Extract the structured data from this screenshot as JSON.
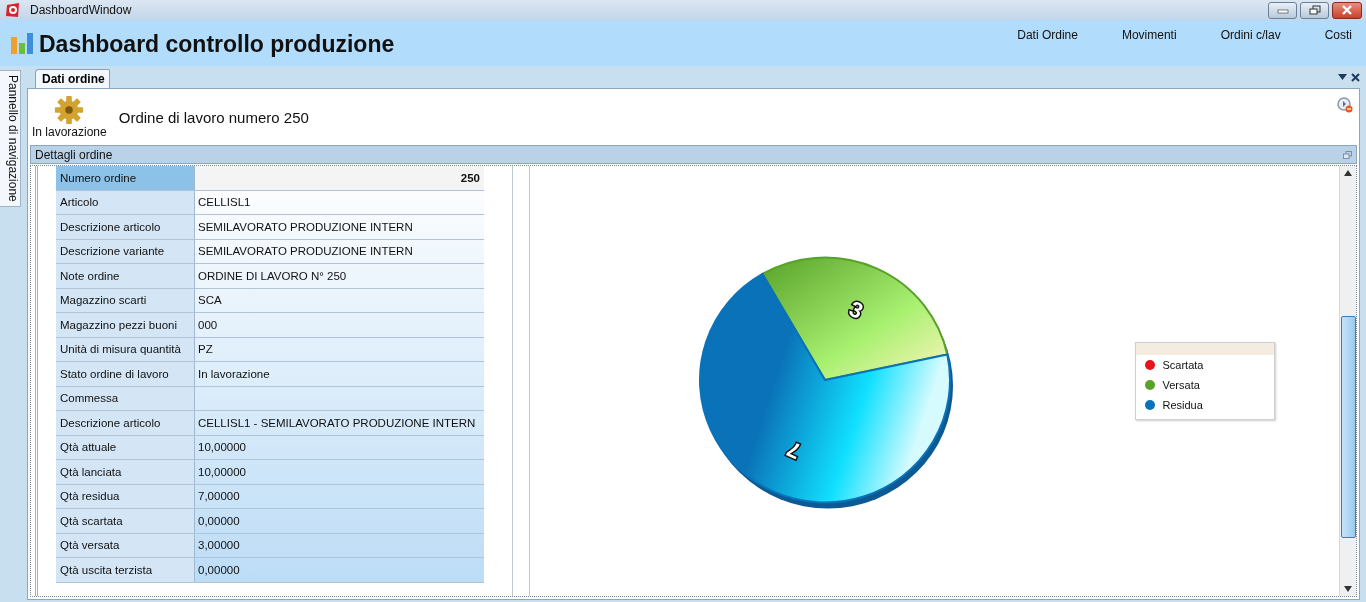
{
  "window": {
    "title": "DashboardWindow"
  },
  "header": {
    "title": "Dashboard controllo produzione",
    "menu": [
      {
        "label": "Dati Ordine"
      },
      {
        "label": "Movimenti"
      },
      {
        "label": "Ordini c/lav"
      },
      {
        "label": "Costi"
      }
    ]
  },
  "side_panel": {
    "label": "Pannello di navigazione"
  },
  "tabs": [
    {
      "label": "Dati ordine",
      "selected": true
    }
  ],
  "order": {
    "status": "In lavorazione",
    "title": "Ordine di lavoro numero 250"
  },
  "details": {
    "title": "Dettagli ordine",
    "rows": [
      {
        "label": "Numero ordine",
        "value": "250",
        "selected": true
      },
      {
        "label": "Articolo",
        "value": "CELLISL1",
        "selected": false
      },
      {
        "label": "Descrizione articolo",
        "value": "SEMILAVORATO PRODUZIONE INTERN",
        "selected": false
      },
      {
        "label": "Descrizione variante",
        "value": "SEMILAVORATO PRODUZIONE INTERN",
        "selected": false
      },
      {
        "label": "Note ordine",
        "value": "ORDINE DI LAVORO N° 250",
        "selected": false
      },
      {
        "label": "Magazzino scarti",
        "value": "SCA",
        "selected": false
      },
      {
        "label": "Magazzino pezzi buoni",
        "value": "000",
        "selected": false
      },
      {
        "label": "Unità di misura quantità",
        "value": "PZ",
        "selected": false
      },
      {
        "label": "Stato ordine di lavoro",
        "value": "In lavorazione",
        "selected": false
      },
      {
        "label": "Commessa",
        "selected": false
      },
      {
        "label": "Descrizione articolo",
        "value": "CELLISL1 - SEMILAVORATO PRODUZIONE INTERN",
        "selected": false
      },
      {
        "label": "Qtà attuale",
        "value": "10,00000",
        "selected": false
      },
      {
        "label": "Qtà lanciata",
        "value": "10,00000",
        "selected": false
      },
      {
        "label": "Qtà residua",
        "value": "7,00000",
        "selected": false
      },
      {
        "label": "Qtà scartata",
        "value": "0,00000",
        "selected": false
      },
      {
        "label": "Qtà versata",
        "value": "3,00000",
        "selected": false
      },
      {
        "label": "Qtà uscita terzista",
        "value": "0,00000",
        "selected": false
      }
    ],
    "chart_data": {
      "type": "pie",
      "categories": [
        "Scartata",
        "Versata",
        "Residua"
      ],
      "series": [
        {
          "values": [
            0,
            3,
            7
          ]
        }
      ],
      "colors": [
        "#e8131b",
        "#58a22a",
        "#0a72b8"
      ],
      "data_labels": true
    }
  }
}
